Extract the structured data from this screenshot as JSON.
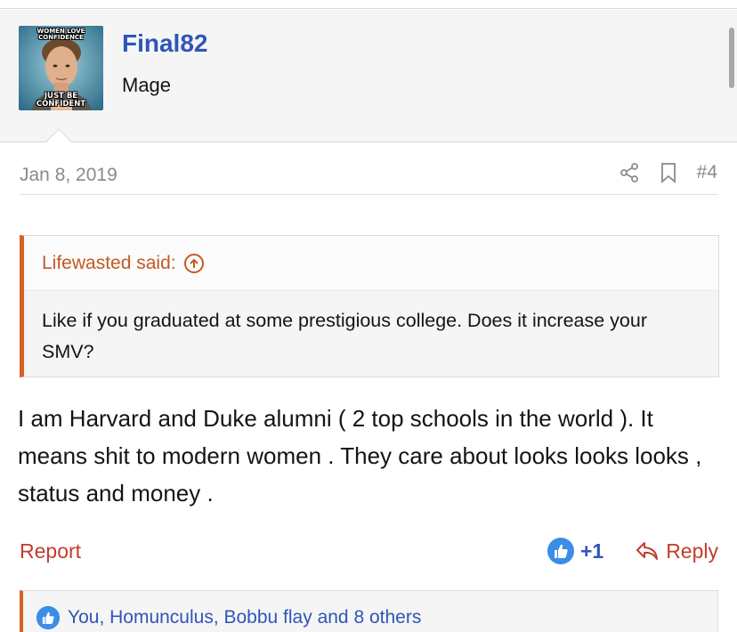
{
  "user": {
    "username": "Final82",
    "title": "Mage",
    "avatar_caption_top": "WOMEN LOVE CONFIDENCE",
    "avatar_caption_bottom": "JUST BE CONFIDENT"
  },
  "post": {
    "date": "Jan 8, 2019",
    "number": "#4",
    "quote": {
      "author": "Lifewasted said:",
      "text": "Like if you graduated at some prestigious college. Does it increase your SMV?"
    },
    "message": "I am Harvard and Duke alumni ( 2 top schools in the world ). It means shit to modern women . They care about looks looks looks , status and money .",
    "footer": {
      "report_label": "Report",
      "like_count": "+1",
      "reply_label": "Reply"
    },
    "reactions_text": "You, Homunculus, Bobbu flay and 8 others"
  },
  "colors": {
    "username": "#2f55b9",
    "quote_accent": "#d66026",
    "action_red": "#c43c2c",
    "like_blue": "#3b8de8"
  },
  "icons": [
    "share-icon",
    "bookmark-icon",
    "arrow-up-circle-icon",
    "like-thumb-icon",
    "reply-arrow-icon"
  ]
}
